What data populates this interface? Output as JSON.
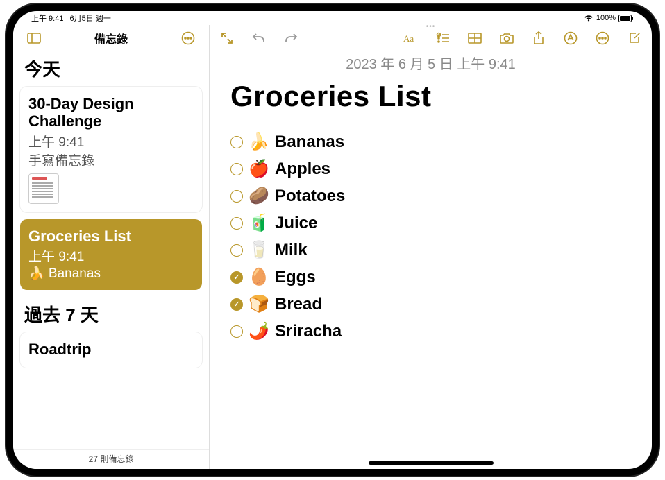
{
  "statusbar": {
    "time": "上午 9:41",
    "date": "6月5日 週一",
    "battery_pct": "100%"
  },
  "sidebar": {
    "title": "備忘錄",
    "sections": [
      {
        "header": "今天",
        "notes": [
          {
            "title": "30-Day Design Challenge",
            "time": "上午 9:41",
            "preview": "手寫備忘錄",
            "has_thumb": true,
            "selected": false
          },
          {
            "title": "Groceries List",
            "time": "上午 9:41",
            "preview": "🍌 Bananas",
            "has_thumb": false,
            "selected": true
          }
        ]
      },
      {
        "header": "過去 7 天",
        "notes": [
          {
            "title": "Roadtrip",
            "time": "",
            "preview": "",
            "has_thumb": false,
            "selected": false
          }
        ]
      }
    ],
    "footer": "27 則備忘錄"
  },
  "editor": {
    "date": "2023 年 6 月 5 日 上午 9:41",
    "title": "Groceries List",
    "items": [
      {
        "checked": false,
        "emoji": "🍌",
        "label": "Bananas"
      },
      {
        "checked": false,
        "emoji": "🍎",
        "label": "Apples"
      },
      {
        "checked": false,
        "emoji": "🥔",
        "label": "Potatoes"
      },
      {
        "checked": false,
        "emoji": "🧃",
        "label": "Juice"
      },
      {
        "checked": false,
        "emoji": "🥛",
        "label": "Milk"
      },
      {
        "checked": true,
        "emoji": "🥚",
        "label": "Eggs"
      },
      {
        "checked": true,
        "emoji": "🍞",
        "label": "Bread"
      },
      {
        "checked": false,
        "emoji": "🌶️",
        "label": "Sriracha"
      }
    ]
  }
}
